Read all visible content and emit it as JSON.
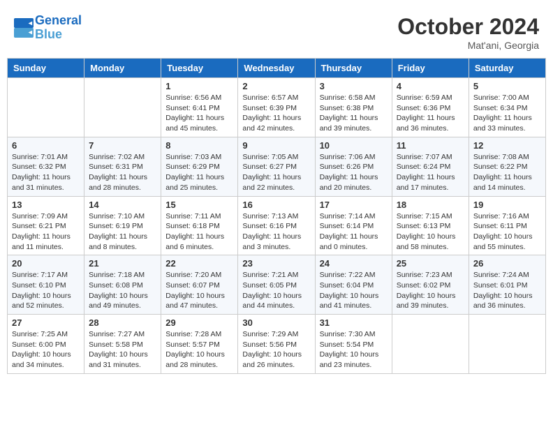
{
  "header": {
    "logo_line1": "General",
    "logo_line2": "Blue",
    "month_title": "October 2024",
    "subtitle": "Mat'ani, Georgia"
  },
  "days_of_week": [
    "Sunday",
    "Monday",
    "Tuesday",
    "Wednesday",
    "Thursday",
    "Friday",
    "Saturday"
  ],
  "weeks": [
    [
      {
        "day": "",
        "info": ""
      },
      {
        "day": "",
        "info": ""
      },
      {
        "day": "1",
        "info": "Sunrise: 6:56 AM\nSunset: 6:41 PM\nDaylight: 11 hours and 45 minutes."
      },
      {
        "day": "2",
        "info": "Sunrise: 6:57 AM\nSunset: 6:39 PM\nDaylight: 11 hours and 42 minutes."
      },
      {
        "day": "3",
        "info": "Sunrise: 6:58 AM\nSunset: 6:38 PM\nDaylight: 11 hours and 39 minutes."
      },
      {
        "day": "4",
        "info": "Sunrise: 6:59 AM\nSunset: 6:36 PM\nDaylight: 11 hours and 36 minutes."
      },
      {
        "day": "5",
        "info": "Sunrise: 7:00 AM\nSunset: 6:34 PM\nDaylight: 11 hours and 33 minutes."
      }
    ],
    [
      {
        "day": "6",
        "info": "Sunrise: 7:01 AM\nSunset: 6:32 PM\nDaylight: 11 hours and 31 minutes."
      },
      {
        "day": "7",
        "info": "Sunrise: 7:02 AM\nSunset: 6:31 PM\nDaylight: 11 hours and 28 minutes."
      },
      {
        "day": "8",
        "info": "Sunrise: 7:03 AM\nSunset: 6:29 PM\nDaylight: 11 hours and 25 minutes."
      },
      {
        "day": "9",
        "info": "Sunrise: 7:05 AM\nSunset: 6:27 PM\nDaylight: 11 hours and 22 minutes."
      },
      {
        "day": "10",
        "info": "Sunrise: 7:06 AM\nSunset: 6:26 PM\nDaylight: 11 hours and 20 minutes."
      },
      {
        "day": "11",
        "info": "Sunrise: 7:07 AM\nSunset: 6:24 PM\nDaylight: 11 hours and 17 minutes."
      },
      {
        "day": "12",
        "info": "Sunrise: 7:08 AM\nSunset: 6:22 PM\nDaylight: 11 hours and 14 minutes."
      }
    ],
    [
      {
        "day": "13",
        "info": "Sunrise: 7:09 AM\nSunset: 6:21 PM\nDaylight: 11 hours and 11 minutes."
      },
      {
        "day": "14",
        "info": "Sunrise: 7:10 AM\nSunset: 6:19 PM\nDaylight: 11 hours and 8 minutes."
      },
      {
        "day": "15",
        "info": "Sunrise: 7:11 AM\nSunset: 6:18 PM\nDaylight: 11 hours and 6 minutes."
      },
      {
        "day": "16",
        "info": "Sunrise: 7:13 AM\nSunset: 6:16 PM\nDaylight: 11 hours and 3 minutes."
      },
      {
        "day": "17",
        "info": "Sunrise: 7:14 AM\nSunset: 6:14 PM\nDaylight: 11 hours and 0 minutes."
      },
      {
        "day": "18",
        "info": "Sunrise: 7:15 AM\nSunset: 6:13 PM\nDaylight: 10 hours and 58 minutes."
      },
      {
        "day": "19",
        "info": "Sunrise: 7:16 AM\nSunset: 6:11 PM\nDaylight: 10 hours and 55 minutes."
      }
    ],
    [
      {
        "day": "20",
        "info": "Sunrise: 7:17 AM\nSunset: 6:10 PM\nDaylight: 10 hours and 52 minutes."
      },
      {
        "day": "21",
        "info": "Sunrise: 7:18 AM\nSunset: 6:08 PM\nDaylight: 10 hours and 49 minutes."
      },
      {
        "day": "22",
        "info": "Sunrise: 7:20 AM\nSunset: 6:07 PM\nDaylight: 10 hours and 47 minutes."
      },
      {
        "day": "23",
        "info": "Sunrise: 7:21 AM\nSunset: 6:05 PM\nDaylight: 10 hours and 44 minutes."
      },
      {
        "day": "24",
        "info": "Sunrise: 7:22 AM\nSunset: 6:04 PM\nDaylight: 10 hours and 41 minutes."
      },
      {
        "day": "25",
        "info": "Sunrise: 7:23 AM\nSunset: 6:02 PM\nDaylight: 10 hours and 39 minutes."
      },
      {
        "day": "26",
        "info": "Sunrise: 7:24 AM\nSunset: 6:01 PM\nDaylight: 10 hours and 36 minutes."
      }
    ],
    [
      {
        "day": "27",
        "info": "Sunrise: 7:25 AM\nSunset: 6:00 PM\nDaylight: 10 hours and 34 minutes."
      },
      {
        "day": "28",
        "info": "Sunrise: 7:27 AM\nSunset: 5:58 PM\nDaylight: 10 hours and 31 minutes."
      },
      {
        "day": "29",
        "info": "Sunrise: 7:28 AM\nSunset: 5:57 PM\nDaylight: 10 hours and 28 minutes."
      },
      {
        "day": "30",
        "info": "Sunrise: 7:29 AM\nSunset: 5:56 PM\nDaylight: 10 hours and 26 minutes."
      },
      {
        "day": "31",
        "info": "Sunrise: 7:30 AM\nSunset: 5:54 PM\nDaylight: 10 hours and 23 minutes."
      },
      {
        "day": "",
        "info": ""
      },
      {
        "day": "",
        "info": ""
      }
    ]
  ]
}
